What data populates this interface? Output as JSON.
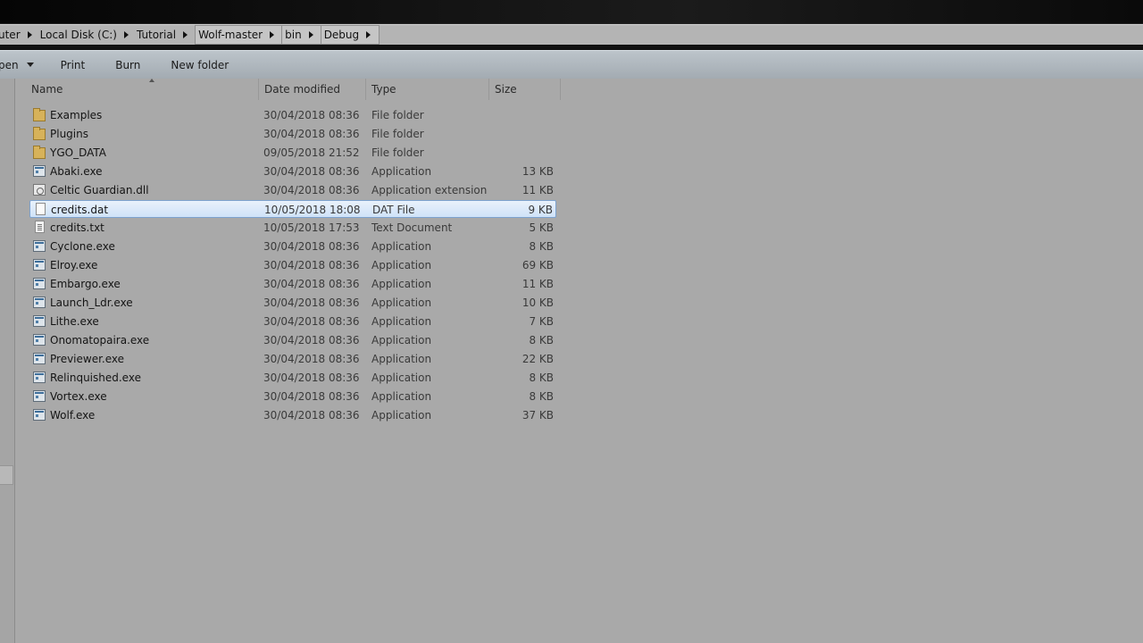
{
  "breadcrumb": {
    "items": [
      {
        "label": "uter"
      },
      {
        "label": "Local Disk (C:)"
      },
      {
        "label": "Tutorial"
      },
      {
        "label": "Wolf-master"
      },
      {
        "label": "bin"
      },
      {
        "label": "Debug"
      }
    ]
  },
  "toolbar": {
    "open_label": "pen",
    "print_label": "Print",
    "burn_label": "Burn",
    "new_folder_label": "New folder"
  },
  "columns": {
    "name": "Name",
    "date": "Date modified",
    "type": "Type",
    "size": "Size"
  },
  "files": [
    {
      "name": "Examples",
      "date": "30/04/2018 08:36",
      "type": "File folder",
      "size": "",
      "icon": "folder-icon"
    },
    {
      "name": "Plugins",
      "date": "30/04/2018 08:36",
      "type": "File folder",
      "size": "",
      "icon": "folder-icon"
    },
    {
      "name": "YGO_DATA",
      "date": "09/05/2018 21:52",
      "type": "File folder",
      "size": "",
      "icon": "folder-icon"
    },
    {
      "name": "Abaki.exe",
      "date": "30/04/2018 08:36",
      "type": "Application",
      "size": "13 KB",
      "icon": "application-icon"
    },
    {
      "name": "Celtic Guardian.dll",
      "date": "30/04/2018 08:36",
      "type": "Application extension",
      "size": "11 KB",
      "icon": "dll-icon"
    },
    {
      "name": "credits.dat",
      "date": "10/05/2018 18:08",
      "type": "DAT File",
      "size": "9 KB",
      "icon": "file-icon",
      "selected": true
    },
    {
      "name": "credits.txt",
      "date": "10/05/2018 17:53",
      "type": "Text Document",
      "size": "5 KB",
      "icon": "text-file-icon"
    },
    {
      "name": "Cyclone.exe",
      "date": "30/04/2018 08:36",
      "type": "Application",
      "size": "8 KB",
      "icon": "application-icon"
    },
    {
      "name": "Elroy.exe",
      "date": "30/04/2018 08:36",
      "type": "Application",
      "size": "69 KB",
      "icon": "application-icon"
    },
    {
      "name": "Embargo.exe",
      "date": "30/04/2018 08:36",
      "type": "Application",
      "size": "11 KB",
      "icon": "application-icon"
    },
    {
      "name": "Launch_Ldr.exe",
      "date": "30/04/2018 08:36",
      "type": "Application",
      "size": "10 KB",
      "icon": "application-icon"
    },
    {
      "name": "Lithe.exe",
      "date": "30/04/2018 08:36",
      "type": "Application",
      "size": "7 KB",
      "icon": "application-icon"
    },
    {
      "name": "Onomatopaira.exe",
      "date": "30/04/2018 08:36",
      "type": "Application",
      "size": "8 KB",
      "icon": "application-icon"
    },
    {
      "name": "Previewer.exe",
      "date": "30/04/2018 08:36",
      "type": "Application",
      "size": "22 KB",
      "icon": "application-icon"
    },
    {
      "name": "Relinquished.exe",
      "date": "30/04/2018 08:36",
      "type": "Application",
      "size": "8 KB",
      "icon": "application-icon"
    },
    {
      "name": "Vortex.exe",
      "date": "30/04/2018 08:36",
      "type": "Application",
      "size": "8 KB",
      "icon": "application-icon"
    },
    {
      "name": "Wolf.exe",
      "date": "30/04/2018 08:36",
      "type": "Application",
      "size": "37 KB",
      "icon": "application-icon"
    }
  ]
}
